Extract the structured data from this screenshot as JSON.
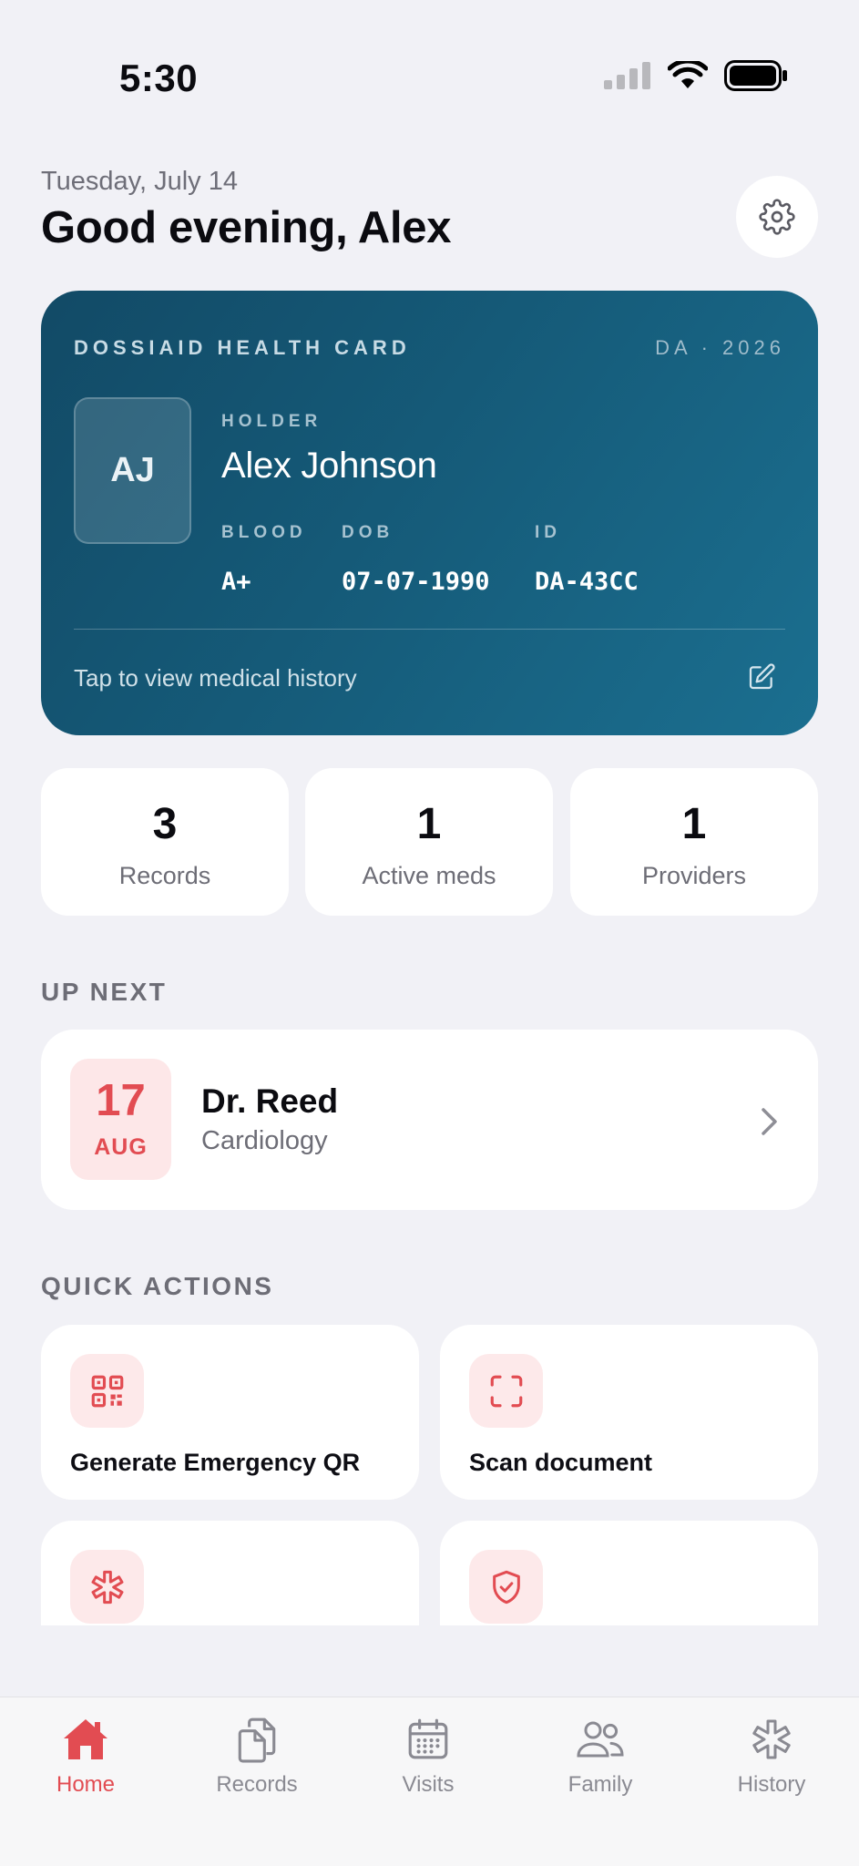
{
  "status_bar": {
    "time": "5:30"
  },
  "header": {
    "date": "Tuesday, July 14",
    "greeting": "Good evening, Alex",
    "settings_icon": "gear-icon"
  },
  "health_card": {
    "title": "DOSSIAID HEALTH CARD",
    "code": "DA · 2026",
    "initials": "AJ",
    "holder_label": "HOLDER",
    "holder_name": "Alex Johnson",
    "blood_label": "BLOOD",
    "blood_value": "A+",
    "dob_label": "DOB",
    "dob_value": "07-07-1990",
    "id_label": "ID",
    "id_value": "DA-43CC",
    "footer_text": "Tap to view medical history",
    "footer_icon": "edit-icon",
    "colors": {
      "gradient_start": "#124a66",
      "gradient_end": "#1b6f90"
    }
  },
  "stats": [
    {
      "value": "3",
      "label": "Records"
    },
    {
      "value": "1",
      "label": "Active meds"
    },
    {
      "value": "1",
      "label": "Providers"
    }
  ],
  "up_next": {
    "heading": "UP NEXT",
    "day": "17",
    "month": "AUG",
    "doctor": "Dr. Reed",
    "specialty": "Cardiology"
  },
  "quick_actions": {
    "heading": "QUICK ACTIONS",
    "items": [
      {
        "label": "Generate Emergency QR",
        "icon": "qr-code-icon"
      },
      {
        "label": "Scan document",
        "icon": "scan-icon"
      },
      {
        "label": "",
        "icon": "medical-asterisk-icon"
      },
      {
        "label": "",
        "icon": "shield-check-icon"
      }
    ]
  },
  "tab_bar": {
    "tabs": [
      {
        "label": "Home",
        "icon": "house-icon",
        "active": true
      },
      {
        "label": "Records",
        "icon": "documents-icon",
        "active": false
      },
      {
        "label": "Visits",
        "icon": "calendar-icon",
        "active": false
      },
      {
        "label": "Family",
        "icon": "people-icon",
        "active": false
      },
      {
        "label": "History",
        "icon": "medical-asterisk-icon",
        "active": false
      }
    ]
  },
  "colors": {
    "accent": "#e24c52",
    "background": "#f1f1f6",
    "card_surface": "#ffffff",
    "muted_text": "#6d6d76"
  }
}
